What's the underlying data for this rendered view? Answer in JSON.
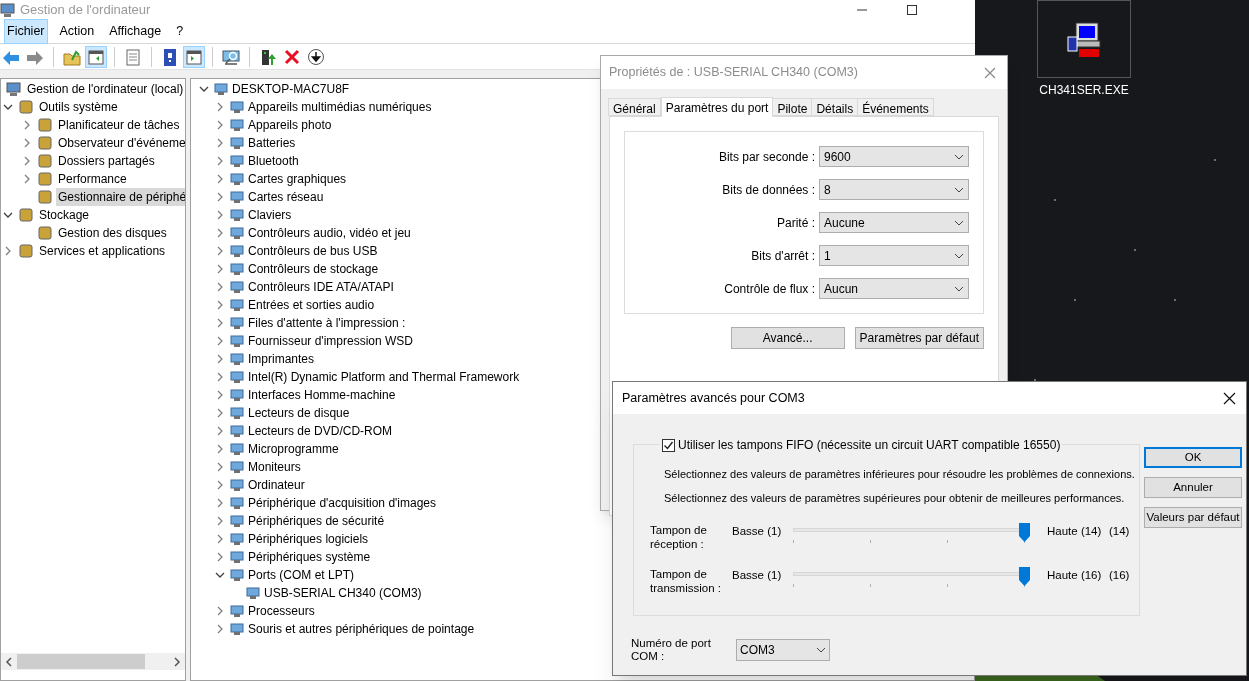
{
  "main_window": {
    "title": "Gestion de l'ordinateur",
    "menu": [
      {
        "label": "Fichier",
        "selected": true
      },
      {
        "label": "Action",
        "selected": false
      },
      {
        "label": "Affichage",
        "selected": false
      },
      {
        "label": "?",
        "selected": false
      }
    ],
    "toolbar": [
      [
        {
          "kind": "back",
          "pressed": false
        },
        {
          "kind": "forward",
          "pressed": false
        }
      ],
      [
        {
          "kind": "folder",
          "pressed": false
        },
        {
          "kind": "tree",
          "pressed": true
        }
      ],
      [
        {
          "kind": "sheet",
          "pressed": false
        }
      ],
      [
        {
          "kind": "help",
          "pressed": false
        },
        {
          "kind": "pane",
          "pressed": true
        }
      ],
      [
        {
          "kind": "scan",
          "pressed": false
        }
      ],
      [
        {
          "kind": "enable",
          "pressed": false
        },
        {
          "kind": "remove",
          "pressed": false
        },
        {
          "kind": "update",
          "pressed": false
        }
      ]
    ],
    "console_tree": [
      {
        "label": "Gestion de l'ordinateur (local)",
        "kind": "root",
        "selected": false,
        "children": [
          {
            "label": "Outils système",
            "kind": "branch",
            "expanded": true,
            "selected": false,
            "children": [
              {
                "label": "Planificateur de tâches",
                "kind": "branch",
                "expanded": false,
                "selected": false
              },
              {
                "label": "Observateur d'événeme",
                "kind": "branch",
                "expanded": false,
                "selected": false
              },
              {
                "label": "Dossiers partagés",
                "kind": "branch",
                "expanded": false,
                "selected": false
              },
              {
                "label": "Performance",
                "kind": "branch",
                "expanded": false,
                "selected": false
              },
              {
                "label": "Gestionnaire de périphé",
                "kind": "leaf",
                "selected": true
              }
            ]
          },
          {
            "label": "Stockage",
            "kind": "branch",
            "expanded": true,
            "selected": false,
            "children": [
              {
                "label": "Gestion des disques",
                "kind": "leaf",
                "selected": false
              }
            ]
          },
          {
            "label": "Services et applications",
            "kind": "branch",
            "expanded": false,
            "selected": false
          }
        ]
      }
    ],
    "device_tree": [
      {
        "label": "DESKTOP-MAC7U8F",
        "kind": "branch",
        "expanded": true,
        "children": [
          {
            "label": "Appareils multimédias numériques",
            "kind": "branch",
            "expanded": false
          },
          {
            "label": "Appareils photo",
            "kind": "branch",
            "expanded": false
          },
          {
            "label": "Batteries",
            "kind": "branch",
            "expanded": false
          },
          {
            "label": "Bluetooth",
            "kind": "branch",
            "expanded": false
          },
          {
            "label": "Cartes graphiques",
            "kind": "branch",
            "expanded": false
          },
          {
            "label": "Cartes réseau",
            "kind": "branch",
            "expanded": false
          },
          {
            "label": "Claviers",
            "kind": "branch",
            "expanded": false
          },
          {
            "label": "Contrôleurs audio, vidéo et jeu",
            "kind": "branch",
            "expanded": false
          },
          {
            "label": "Contrôleurs de bus USB",
            "kind": "branch",
            "expanded": false
          },
          {
            "label": "Contrôleurs de stockage",
            "kind": "branch",
            "expanded": false
          },
          {
            "label": "Contrôleurs IDE ATA/ATAPI",
            "kind": "branch",
            "expanded": false
          },
          {
            "label": "Entrées et sorties audio",
            "kind": "branch",
            "expanded": false
          },
          {
            "label": "Files d'attente à l'impression :",
            "kind": "branch",
            "expanded": false
          },
          {
            "label": "Fournisseur d'impression WSD",
            "kind": "branch",
            "expanded": false
          },
          {
            "label": "Imprimantes",
            "kind": "branch",
            "expanded": false
          },
          {
            "label": "Intel(R) Dynamic Platform and Thermal Framework",
            "kind": "branch",
            "expanded": false
          },
          {
            "label": "Interfaces Homme-machine",
            "kind": "branch",
            "expanded": false
          },
          {
            "label": "Lecteurs de disque",
            "kind": "branch",
            "expanded": false
          },
          {
            "label": "Lecteurs de DVD/CD-ROM",
            "kind": "branch",
            "expanded": false
          },
          {
            "label": "Microprogramme",
            "kind": "branch",
            "expanded": false
          },
          {
            "label": "Moniteurs",
            "kind": "branch",
            "expanded": false
          },
          {
            "label": "Ordinateur",
            "kind": "branch",
            "expanded": false
          },
          {
            "label": "Périphérique d'acquisition d'images",
            "kind": "branch",
            "expanded": false
          },
          {
            "label": "Périphériques de sécurité",
            "kind": "branch",
            "expanded": false
          },
          {
            "label": "Périphériques logiciels",
            "kind": "branch",
            "expanded": false
          },
          {
            "label": "Périphériques système",
            "kind": "branch",
            "expanded": false
          },
          {
            "label": "Ports (COM et LPT)",
            "kind": "branch",
            "expanded": true,
            "children": [
              {
                "label": "USB-SERIAL CH340 (COM3)",
                "kind": "leaf"
              }
            ]
          },
          {
            "label": "Processeurs",
            "kind": "branch",
            "expanded": false
          },
          {
            "label": "Souris et autres périphériques de pointage",
            "kind": "branch",
            "expanded": false
          }
        ]
      }
    ]
  },
  "desktop_icon": {
    "label": "CH341SER.EXE"
  },
  "properties_dialog": {
    "title": "Propriétés de : USB-SERIAL CH340 (COM3)",
    "tabs": [
      {
        "label": "Général",
        "selected": false
      },
      {
        "label": "Paramètres du port",
        "selected": true
      },
      {
        "label": "Pilote",
        "selected": false
      },
      {
        "label": "Détails",
        "selected": false
      },
      {
        "label": "Événements",
        "selected": false
      }
    ],
    "fields": [
      {
        "label": "Bits par seconde :",
        "value": "9600"
      },
      {
        "label": "Bits de données :",
        "value": "8"
      },
      {
        "label": "Parité :",
        "value": "Aucune"
      },
      {
        "label": "Bits d'arrêt :",
        "value": "1"
      },
      {
        "label": "Contrôle de flux :",
        "value": "Aucun"
      }
    ],
    "buttons": [
      "Avancé...",
      "Paramètres par défaut"
    ]
  },
  "advanced_dialog": {
    "title": "Paramètres avancés pour COM3",
    "fifo": {
      "label": "Utiliser les tampons FIFO (nécessite un circuit UART compatible 16550)",
      "checked": true
    },
    "hints": [
      "Sélectionnez des valeurs de paramètres inférieures pour résoudre les problèmes de connexions.",
      "Sélectionnez des valeurs de paramètres supérieures pour obtenir de meilleures performances."
    ],
    "sliders": [
      {
        "label": "Tampon de réception :",
        "low": "Basse (1)",
        "high": "Haute (14)",
        "reading": "(14)",
        "level": 1
      },
      {
        "label": "Tampon de transmission :",
        "low": "Basse (1)",
        "high": "Haute (16)",
        "reading": "(16)",
        "level": 1
      }
    ],
    "port": {
      "label": "Numéro de port COM :",
      "value": "COM3"
    },
    "buttons": [
      {
        "label": "OK",
        "default": true
      },
      {
        "label": "Annuler",
        "default": false
      },
      {
        "label": "Valeurs par défaut",
        "default": false
      }
    ]
  }
}
